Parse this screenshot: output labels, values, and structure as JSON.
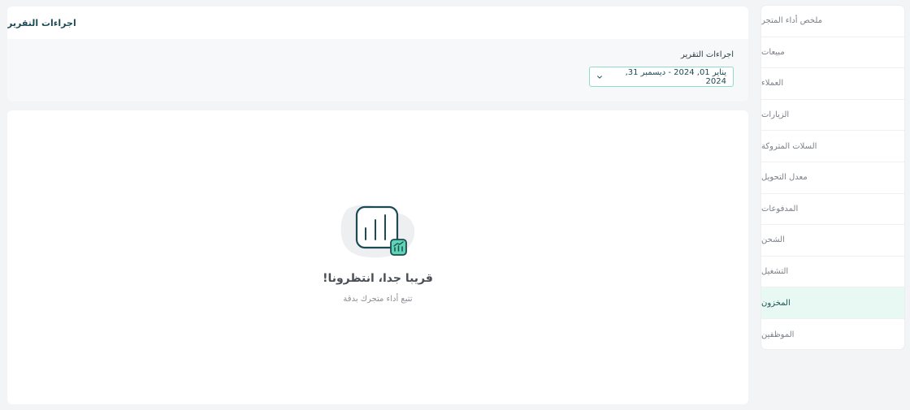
{
  "sidebar": {
    "items": [
      {
        "label": "ملخص أداء المتجر"
      },
      {
        "label": "مبيعات"
      },
      {
        "label": "العملاء"
      },
      {
        "label": "الزيارات"
      },
      {
        "label": "السلات المتروكة"
      },
      {
        "label": "معدل التحويل"
      },
      {
        "label": "المدفوعات"
      },
      {
        "label": "الشحن"
      },
      {
        "label": "التشغيل"
      },
      {
        "label": "المخزون"
      },
      {
        "label": "الموظفين"
      }
    ],
    "active": "المخزون"
  },
  "report": {
    "header_title": "اجراءات التقرير",
    "field_label": "اجراءات التقرير",
    "date_range": "يناير 01, 2024 - ديسمبر 31, 2024"
  },
  "empty_state": {
    "title": "قريبا جدا، انتظرونا!",
    "subtitle": "تتبع أداء متجرك بدقة"
  },
  "colors": {
    "accent": "#1c4a55",
    "active_bg": "#e8f8f2",
    "border_accent": "#8fdcc8",
    "badge_green": "#5fd4b3"
  },
  "icons": [
    "chevron-down-icon",
    "bar-chart-icon",
    "chart-badge-icon"
  ]
}
